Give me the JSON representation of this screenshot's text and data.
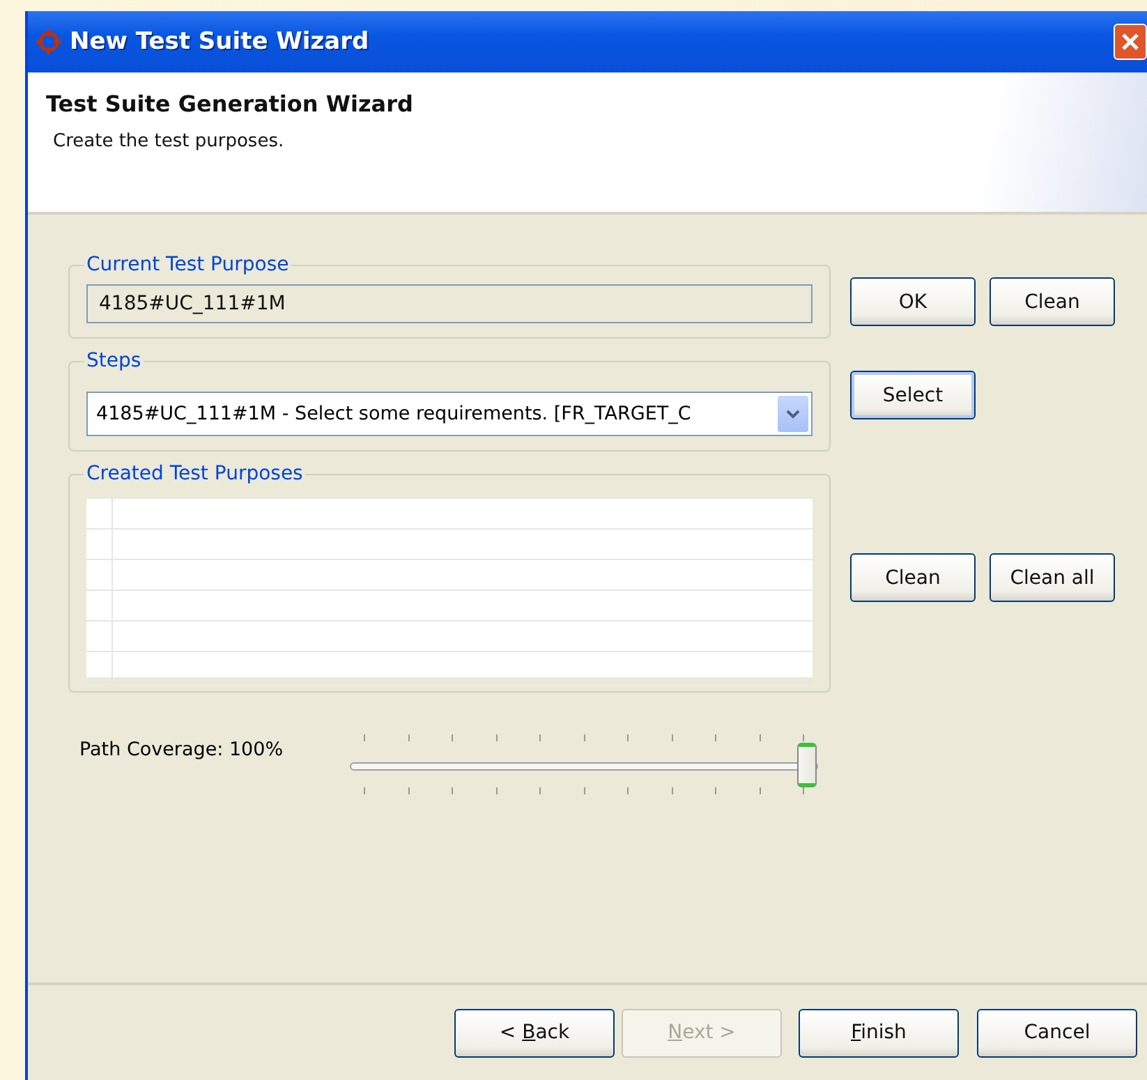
{
  "window": {
    "title": "New Test Suite Wizard"
  },
  "header": {
    "title": "Test Suite Generation Wizard",
    "description": "Create the test purposes."
  },
  "current_test_purpose": {
    "legend": "Current Test Purpose",
    "value": "4185#UC_111#1M",
    "buttons": [
      "OK",
      "Clean"
    ]
  },
  "steps": {
    "legend": "Steps",
    "value": "4185#UC_111#1M - Select some requirements. [FR_TARGET_C",
    "button": "Select"
  },
  "created_test_purposes": {
    "legend": "Created Test Purposes",
    "buttons": [
      "Clean",
      "Clean all"
    ]
  },
  "path_coverage": {
    "label": "Path Coverage: 100%",
    "level": 1
  },
  "footer_buttons": [
    {
      "pre": "< ",
      "key": "B",
      "post": "ack",
      "disabled": false
    },
    {
      "key": "N",
      "post": "ext >",
      "disabled": true
    },
    {
      "key": "F",
      "post": "inish",
      "disabled": false
    },
    {
      "pre": "Cancel",
      "disabled": false
    }
  ]
}
